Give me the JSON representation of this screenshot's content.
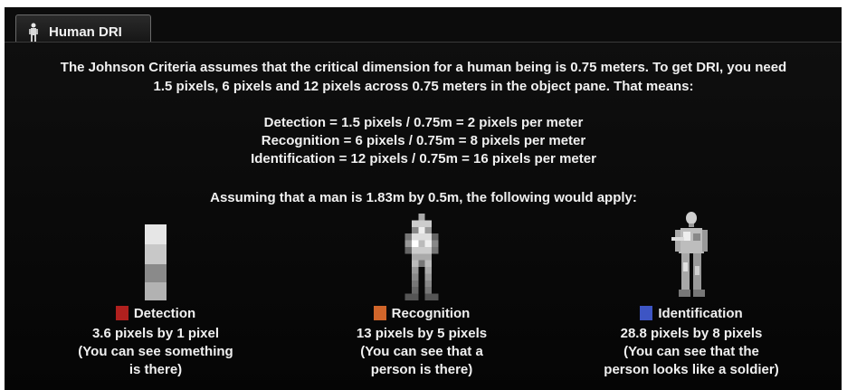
{
  "tab": {
    "label": "Human DRI",
    "icon": "person-icon"
  },
  "intro": {
    "line1": "The Johnson Criteria assumes that the critical dimension for a human being is 0.75 meters. To get DRI, you need",
    "line2": "1.5 pixels, 6 pixels and 12 pixels across 0.75 meters in the object pane. That means:"
  },
  "equations": [
    "Detection = 1.5 pixels / 0.75m = 2 pixels per meter",
    "Recognition = 6 pixels / 0.75m = 8 pixels per meter",
    "Identification = 12 pixels / 0.75m = 16 pixels per meter"
  ],
  "assumption": "Assuming that a man is 1.83m by 0.5m, the following would apply:",
  "levels": [
    {
      "name": "Detection",
      "color": "#b0201e",
      "size": "3.6 pixels by 1 pixel",
      "note1": "(You can see something",
      "note2": "is there)"
    },
    {
      "name": "Recognition",
      "color": "#d0652a",
      "size": "13 pixels by 5 pixels",
      "note1": "(You can see that a",
      "note2": "person is there)"
    },
    {
      "name": "Identification",
      "color": "#3d55c4",
      "size": "28.8 pixels by 8 pixels",
      "note1": "(You can see that the",
      "note2": "person looks like a soldier)"
    }
  ]
}
